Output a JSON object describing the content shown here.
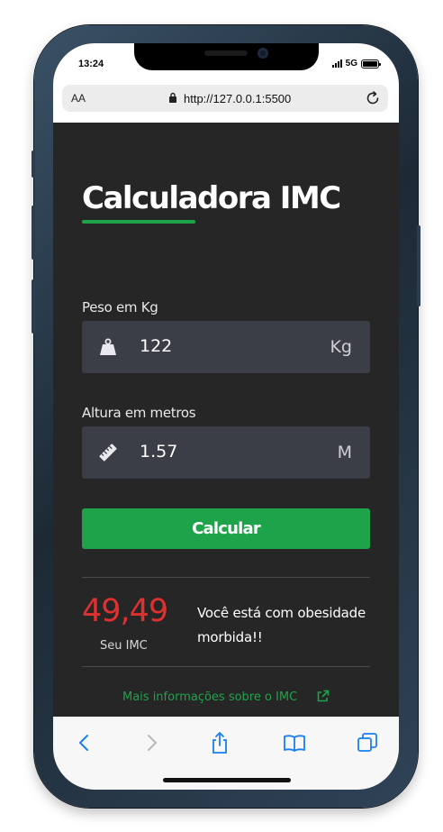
{
  "status_bar": {
    "time": "13:24",
    "network": "5G",
    "battery_level": 1.0
  },
  "browser": {
    "text_size_button": "AA",
    "url": "http://127.0.0.1:5500",
    "reload_icon": "reload-icon",
    "lock_icon": "lock-icon"
  },
  "page": {
    "title": "Calculadora IMC",
    "accent_color": "#1fa34a",
    "weight": {
      "label": "Peso em Kg",
      "value": "122",
      "unit": "Kg",
      "icon": "weight-icon"
    },
    "height": {
      "label": "Altura em metros",
      "value": "1.57",
      "unit": "M",
      "icon": "ruler-icon"
    },
    "calculate_button": "Calcular",
    "result": {
      "imc": "49,49",
      "imc_label": "Seu IMC",
      "imc_color": "#e03131",
      "message": "Você está com obesidade morbida!!"
    },
    "more_info_link": "Mais informações sobre o IMC"
  },
  "toolbar": {
    "icons": [
      "back-icon",
      "forward-icon",
      "share-icon",
      "bookmarks-icon",
      "tabs-icon"
    ],
    "link_color": "#1a7ff0"
  }
}
